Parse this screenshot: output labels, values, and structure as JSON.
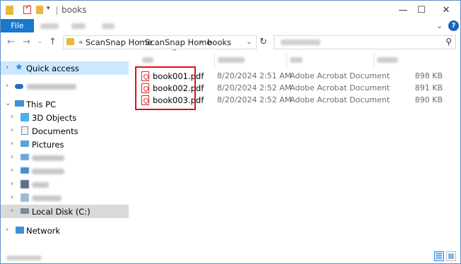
{
  "window": {
    "title": "books"
  },
  "ribbon": {
    "file_tab": "File"
  },
  "address": {
    "overflow": "«",
    "segments": [
      "ScanSnap Home",
      "ScanSnap Home",
      "books"
    ]
  },
  "nav": {
    "quick_access": "Quick access",
    "this_pc": "This PC",
    "objects_3d": "3D Objects",
    "documents": "Documents",
    "pictures": "Pictures",
    "local_disk": "Local Disk (C:)",
    "network": "Network"
  },
  "files": [
    {
      "name": "book001.pdf",
      "date": "8/20/2024 2:51 AM",
      "type": "Adobe Acrobat Document",
      "size": "898 KB"
    },
    {
      "name": "book002.pdf",
      "date": "8/20/2024 2:52 AM",
      "type": "Adobe Acrobat Document",
      "size": "891 KB"
    },
    {
      "name": "book003.pdf",
      "date": "8/20/2024 2:52 AM",
      "type": "Adobe Acrobat Document",
      "size": "890 KB"
    }
  ],
  "colors": {
    "accent": "#1979ca",
    "highlight": "#e01010",
    "selection": "#cce8ff",
    "folder": "#e8b73d"
  }
}
